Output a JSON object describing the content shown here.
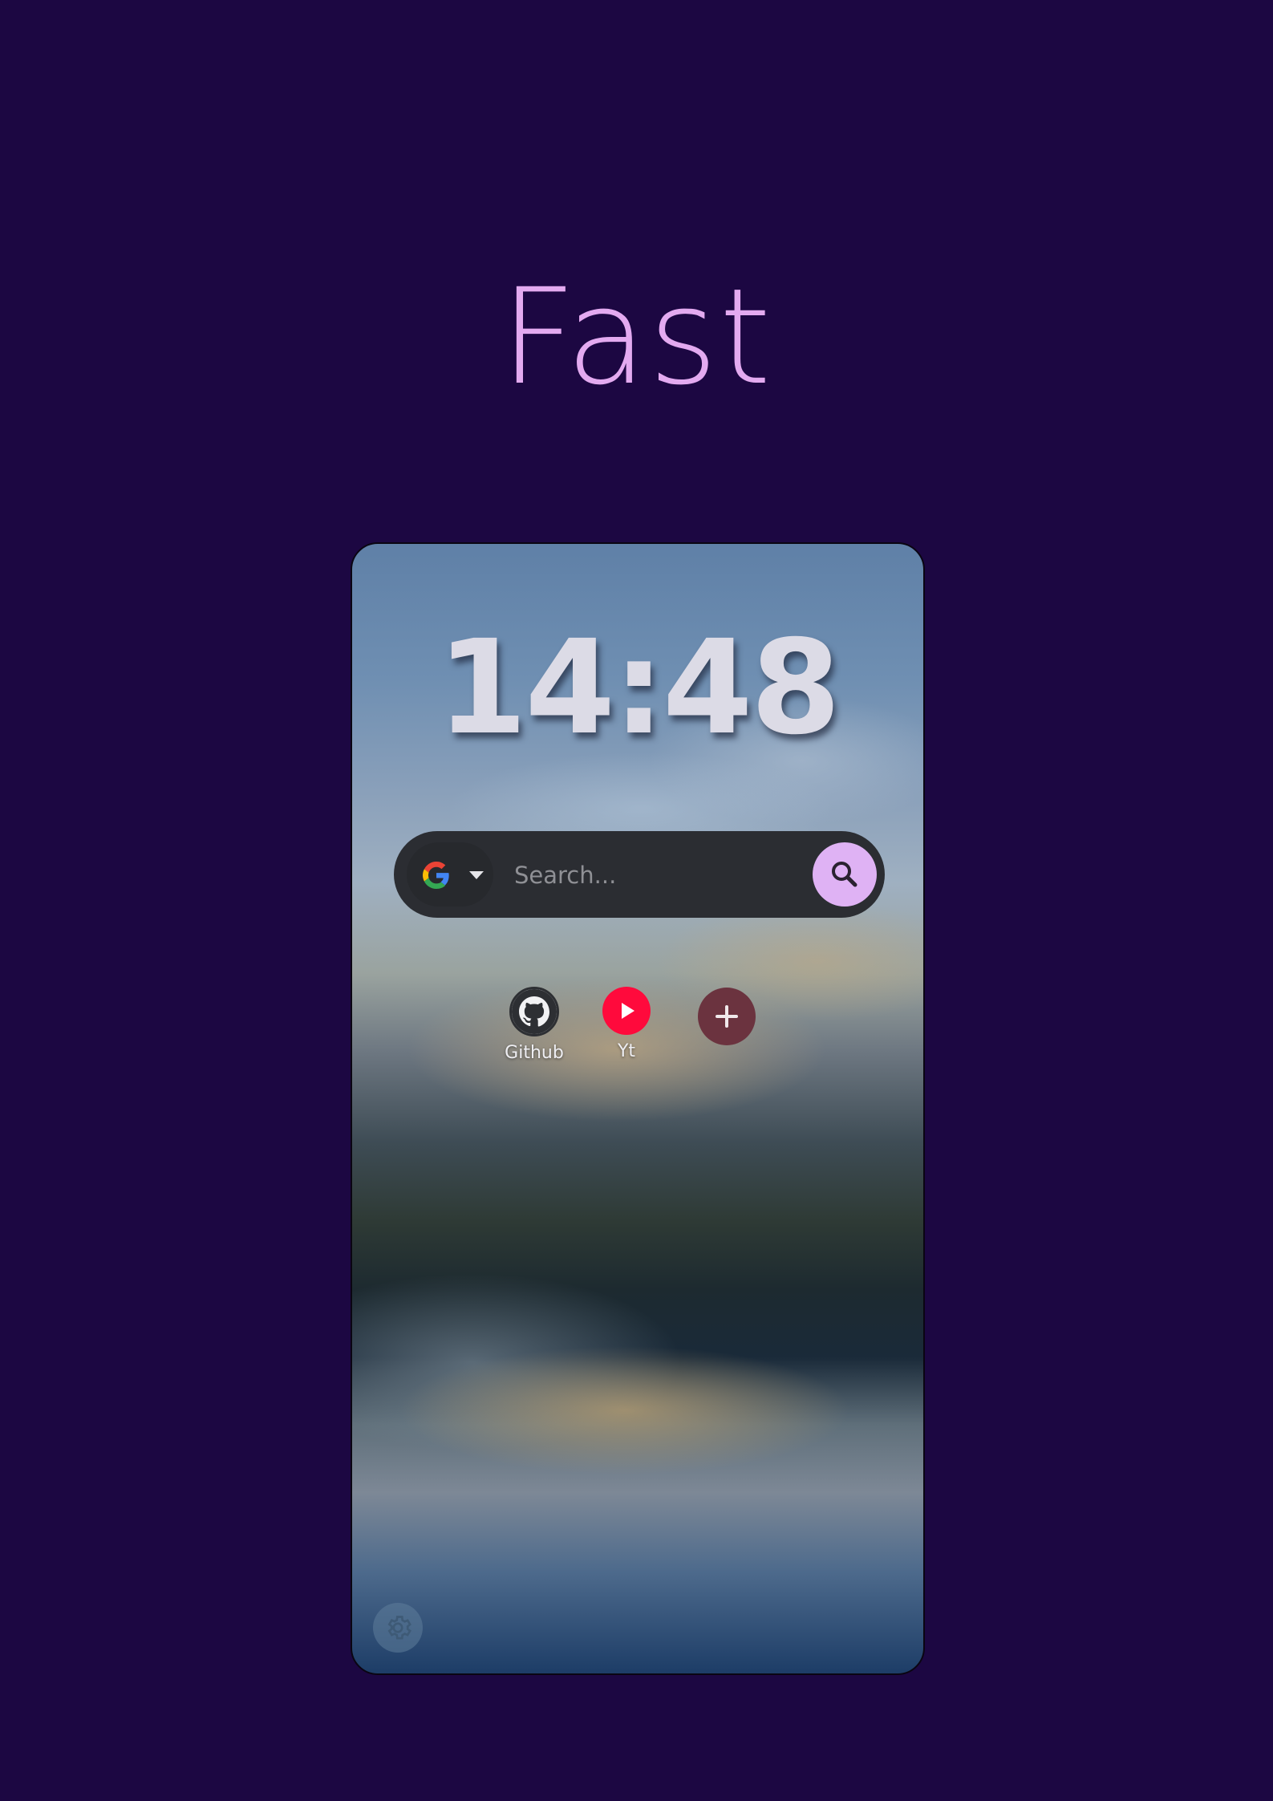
{
  "headline": "Fast",
  "clock": {
    "time": "14:48"
  },
  "search": {
    "engine": "google-icon",
    "placeholder": "Search...",
    "value": ""
  },
  "shortcuts": [
    {
      "label": "Github",
      "icon": "github-icon"
    },
    {
      "label": "Yt",
      "icon": "youtube-icon"
    }
  ],
  "colors": {
    "page_background": "#1c0742",
    "headline": "#e3aaf0",
    "search_button": "#dfb2f4",
    "youtube": "#ff0a3c",
    "add_button": "#6b333f"
  }
}
